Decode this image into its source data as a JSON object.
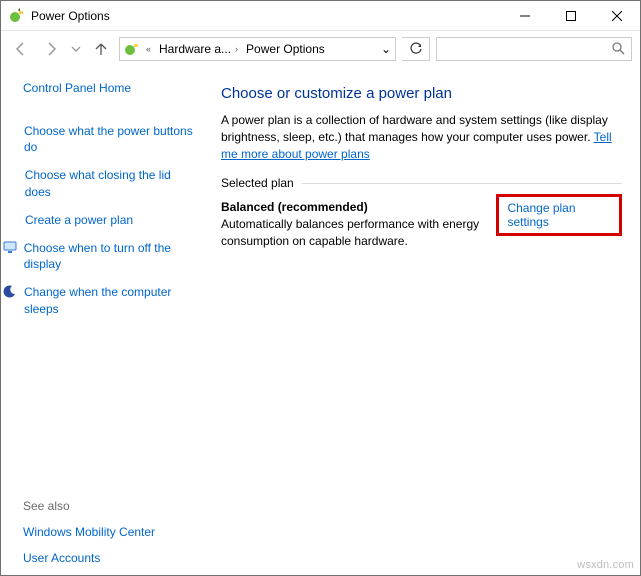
{
  "window": {
    "title": "Power Options"
  },
  "nav": {
    "breadcrumb": {
      "item1": "Hardware a...",
      "item2": "Power Options"
    },
    "search_placeholder": ""
  },
  "sidebar": {
    "home": "Control Panel Home",
    "items": [
      {
        "label": "Choose what the power buttons do",
        "icon": null
      },
      {
        "label": "Choose what closing the lid does",
        "icon": null
      },
      {
        "label": "Create a power plan",
        "icon": null
      },
      {
        "label": "Choose when to turn off the display",
        "icon": "monitor"
      },
      {
        "label": "Change when the computer sleeps",
        "icon": "moon"
      }
    ],
    "see_also_label": "See also",
    "see_also": [
      "Windows Mobility Center",
      "User Accounts"
    ]
  },
  "main": {
    "heading": "Choose or customize a power plan",
    "description": "A power plan is a collection of hardware and system settings (like display brightness, sleep, etc.) that manages how your computer uses power. ",
    "learn_more": "Tell me more about power plans",
    "selected_plan_label": "Selected plan",
    "plan": {
      "name": "Balanced (recommended)",
      "desc": "Automatically balances performance with energy consumption on capable hardware.",
      "change_link": "Change plan settings"
    }
  },
  "watermark": "wsxdn.com"
}
